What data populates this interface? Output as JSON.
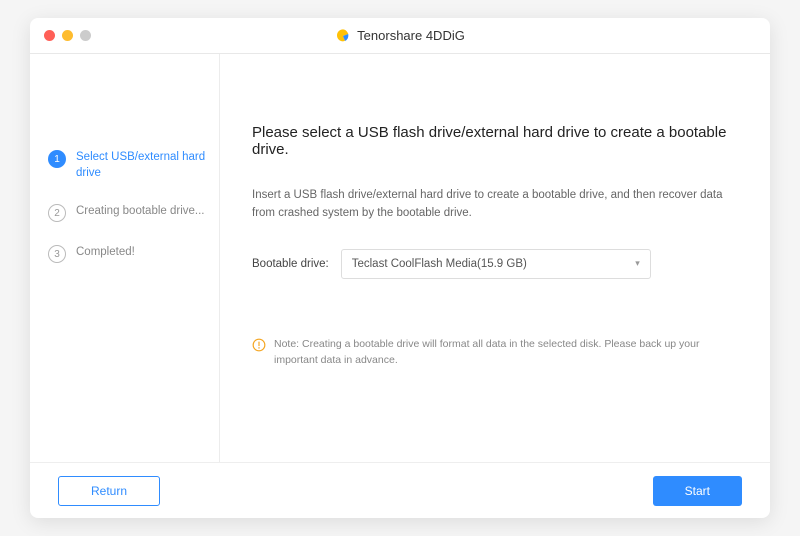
{
  "app": {
    "title": "Tenorshare 4DDiG"
  },
  "sidebar": {
    "steps": [
      {
        "num": "1",
        "label": "Select USB/external hard drive"
      },
      {
        "num": "2",
        "label": "Creating bootable drive..."
      },
      {
        "num": "3",
        "label": "Completed!"
      }
    ]
  },
  "main": {
    "heading": "Please select a USB flash drive/external hard drive to create a bootable drive.",
    "description": "Insert a USB flash drive/external hard drive to create a bootable drive, and then recover data from crashed system by the bootable drive.",
    "dropdown_label": "Bootable drive:",
    "dropdown_value": "Teclast CoolFlash Media(15.9 GB)",
    "note": "Note: Creating a bootable drive will format all data in the selected disk. Please back up your important data in advance."
  },
  "footer": {
    "return_label": "Return",
    "start_label": "Start"
  }
}
